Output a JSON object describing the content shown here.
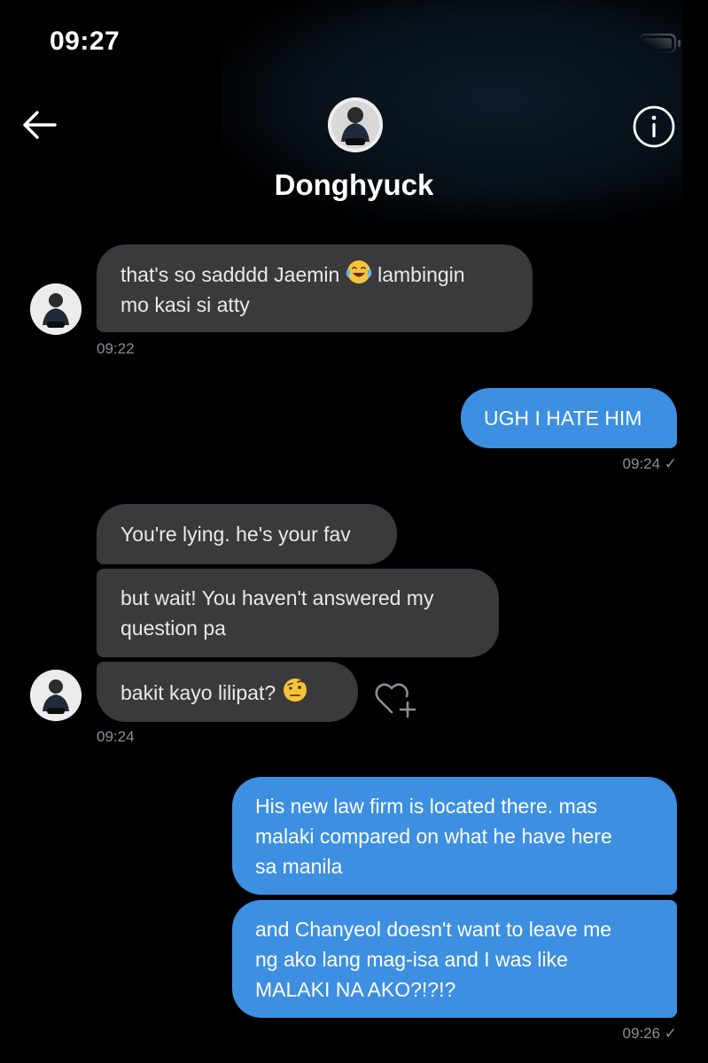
{
  "status_bar": {
    "time": "09:27"
  },
  "header": {
    "contact_name": "Donghyuck"
  },
  "icons": {
    "back": "arrow-left-icon",
    "info": "info-circle-icon",
    "react": "heart-plus-icon",
    "signal": "signal-icon",
    "wifi": "wifi-icon",
    "battery": "battery-icon"
  },
  "colors": {
    "incoming_bubble": "#3a3a3d",
    "outgoing_bubble": "#3d8fe2",
    "background": "#000000"
  },
  "messages": [
    {
      "dir": "in",
      "line1": "that's so sadddd Jaemin",
      "emoji": "face-with-tears-of-joy",
      "line1b": "lambingin",
      "line2": "mo kasi si atty",
      "time": "09:22"
    },
    {
      "dir": "out",
      "text": "UGH I HATE HIM",
      "time": "09:24 ✓"
    },
    {
      "dir": "in",
      "text": "You're lying. he's your fav"
    },
    {
      "dir": "in",
      "line1": "but wait! You haven't answered my",
      "line2": "question pa"
    },
    {
      "dir": "in",
      "text": "bakit kayo lilipat?",
      "emoji": "face-with-raised-eyebrow",
      "time": "09:24"
    },
    {
      "dir": "out",
      "line1": "His new law firm is located there. mas",
      "line2": "malaki compared on what he have here",
      "line3": "sa manila"
    },
    {
      "dir": "out",
      "line1": "and Chanyeol doesn't want to leave me",
      "line2": "ng ako lang mag-isa and I was like",
      "line3": "MALAKI NA AKO?!?!?",
      "time": "09:26 ✓"
    }
  ]
}
